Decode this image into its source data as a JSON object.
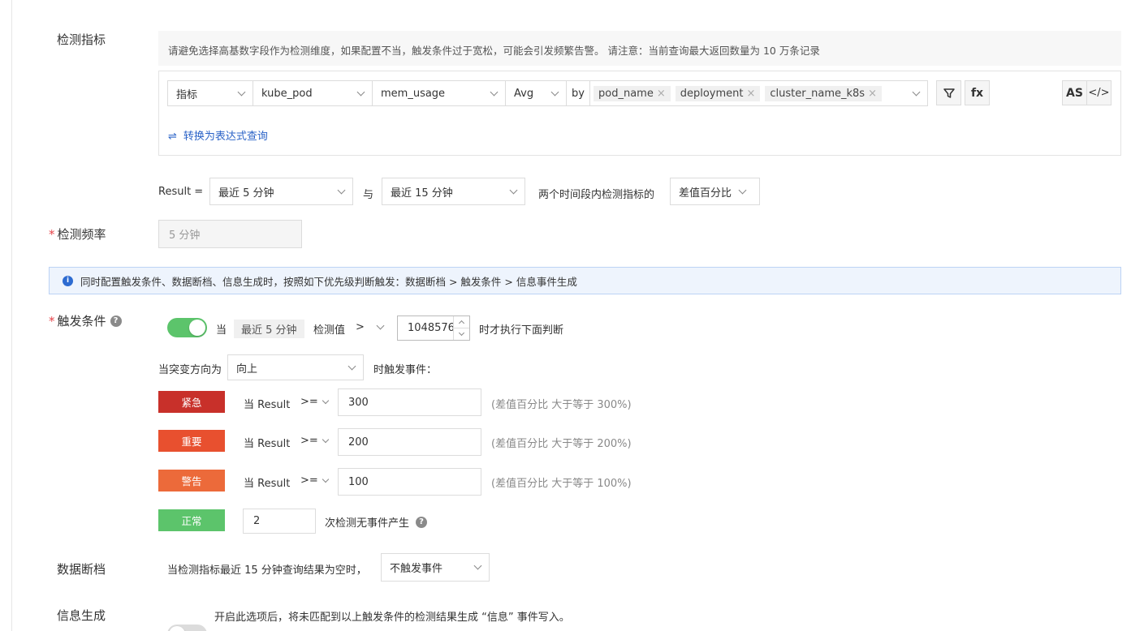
{
  "metric_label": "检测指标",
  "hint_text": "请避免选择高基数字段作为检测维度，如果配置不当，触发条件过于宽松，可能会引发频繁告警。 请注意：当前查询最大返回数量为 10 万条记录",
  "query": {
    "type": "指标",
    "measurement": "kube_pod",
    "field": "mem_usage",
    "agg": "Avg",
    "by": "by",
    "tags": [
      "pod_name",
      "deployment",
      "cluster_name_k8s"
    ],
    "tag_close": "×",
    "filter_icon": "filter-icon",
    "fx": "fx",
    "as": "AS",
    "code": "</>",
    "convert_icon": "⇌",
    "convert": "转换为表达式查询"
  },
  "result": {
    "prefix": "Result =",
    "range1": "最近 5 分钟",
    "and": "与",
    "range2": "最近 15 分钟",
    "mid": "两个时间段内检测指标的",
    "mode": "差值百分比"
  },
  "freq": {
    "label": "检测频率",
    "value": "5 分钟"
  },
  "info": {
    "icon": "i",
    "text": "同时配置触发条件、数据断档、信息生成时，按照如下优先级判断触发：数据断档 > 触发条件 > 信息事件生成"
  },
  "trigger": {
    "label": "触发条件",
    "help": "?",
    "dang": "当",
    "window": "最近 5 分钟",
    "detect": "检测值",
    "op": ">",
    "value": "1048576",
    "after": "时才执行下面判断",
    "direction_label": "当突变方向为",
    "direction": "向上",
    "direction_after": "时触发事件："
  },
  "levels": [
    {
      "name": "紧急",
      "cond": "当 Result",
      "op": ">=",
      "value": "300",
      "note": "(差值百分比 大于等于 300%)",
      "color": "#c8302a"
    },
    {
      "name": "重要",
      "cond": "当 Result",
      "op": ">=",
      "value": "200",
      "note": "(差值百分比 大于等于 200%)",
      "color": "#e8502f"
    },
    {
      "name": "警告",
      "cond": "当 Result",
      "op": ">=",
      "value": "100",
      "note": "(差值百分比 大于等于 100%)",
      "color": "#ec6a3a"
    }
  ],
  "normal": {
    "name": "正常",
    "value": "2",
    "text": "次检测无事件产生",
    "help": "?",
    "color": "#5cc46b"
  },
  "nodata": {
    "label": "数据断档",
    "text": "当检测指标最近 15 分钟查询结果为空时，",
    "action": "不触发事件"
  },
  "infogen": {
    "label": "信息生成",
    "text": "开启此选项后，将未匹配到以上触发条件的检测结果生成 “信息” 事件写入。",
    "enabled": false
  },
  "colors": {
    "toggle_on": "#5cc46b",
    "toggle_off": "#dcdcdc",
    "link": "#2b63c7",
    "info": "#2d6bd1"
  }
}
